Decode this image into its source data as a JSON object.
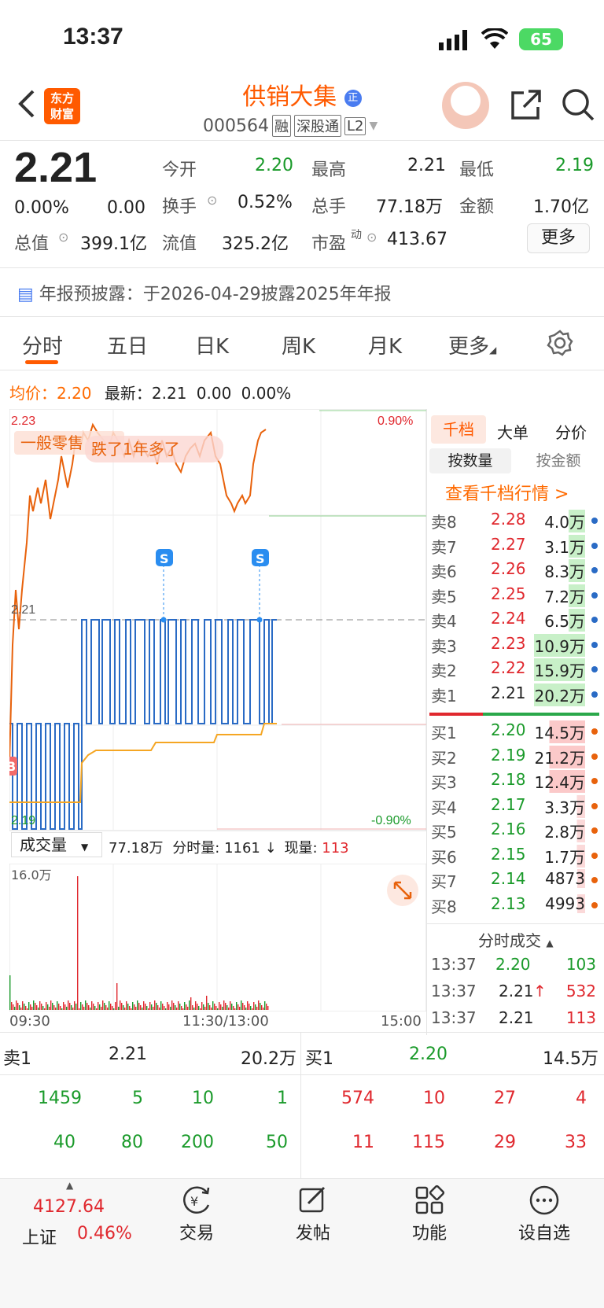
{
  "status": {
    "time": "13:37",
    "battery": "65"
  },
  "header": {
    "back_icon": "chevron-left-icon",
    "logo_text": "东方财富",
    "name": "供销大集",
    "code": "000564",
    "tags": [
      "融",
      "深股通",
      "L2"
    ],
    "share_icon": "share-icon",
    "search_icon": "search-icon"
  },
  "quote": {
    "price": "2.21",
    "change_pct": "0.00%",
    "change": "0.00",
    "open_label": "今开",
    "open": "2.20",
    "high_label": "最高",
    "high": "2.21",
    "low_label": "最低",
    "low": "2.19",
    "turnover_label": "换手",
    "turnover": "0.52%",
    "volume_label": "总手",
    "volume": "77.18万",
    "amount_label": "金额",
    "amount": "1.70亿",
    "mktcap_label": "总值",
    "mktcap": "399.1亿",
    "float_label": "流值",
    "float": "325.2亿",
    "pe_label": "市盈",
    "pe_sup": "动",
    "pe": "413.67",
    "more": "更多"
  },
  "notice": "年报预披露：于2026-04-29披露2025年年报",
  "tabs": [
    "分时",
    "五日",
    "日K",
    "周K",
    "月K",
    "更多"
  ],
  "avg_row": {
    "avg_label": "均价：",
    "avg": "2.20",
    "latest_label": "最新：",
    "latest": "2.21",
    "chg": "0.00",
    "pct": "0.00%"
  },
  "chart": {
    "ymax": "2.23",
    "ymin": "2.19",
    "mid": "2.21",
    "pct_top": "0.90%",
    "pct_bottom": "-0.90%",
    "overlay_tag": "一般零售",
    "overlay_text": "跌了1年多了",
    "sell_marker": "S",
    "buy_marker": "B"
  },
  "vol_header": {
    "select": "成交量",
    "total": "77.18万",
    "fs_label": "分时量:",
    "fs": "1161",
    "now_label": "现量:",
    "now": "113"
  },
  "vol_chart": {
    "ymax": "16.0万",
    "t_start": "09:30",
    "t_mid": "11:30/13:00",
    "t_end": "15:00"
  },
  "chart_data": {
    "type": "line",
    "price_range": [
      2.19,
      2.23
    ],
    "prev_close": 2.21,
    "volume_max": 160000
  },
  "orderbook": {
    "tabs": [
      "千档",
      "大单",
      "分价"
    ],
    "sub_tabs": [
      "按数量",
      "按金额"
    ],
    "link": "查看千档行情 >",
    "asks": [
      {
        "label": "卖8",
        "price": "2.28",
        "vol": "4.0万"
      },
      {
        "label": "卖7",
        "price": "2.27",
        "vol": "3.1万"
      },
      {
        "label": "卖6",
        "price": "2.26",
        "vol": "8.3万"
      },
      {
        "label": "卖5",
        "price": "2.25",
        "vol": "7.2万"
      },
      {
        "label": "卖4",
        "price": "2.24",
        "vol": "6.5万"
      },
      {
        "label": "卖3",
        "price": "2.23",
        "vol": "10.9万"
      },
      {
        "label": "卖2",
        "price": "2.22",
        "vol": "15.9万"
      },
      {
        "label": "卖1",
        "price": "2.21",
        "vol": "20.2万"
      }
    ],
    "bids": [
      {
        "label": "买1",
        "price": "2.20",
        "vol": "14.5万"
      },
      {
        "label": "买2",
        "price": "2.19",
        "vol": "21.2万"
      },
      {
        "label": "买3",
        "price": "2.18",
        "vol": "12.4万"
      },
      {
        "label": "买4",
        "price": "2.17",
        "vol": "3.3万"
      },
      {
        "label": "买5",
        "price": "2.16",
        "vol": "2.8万"
      },
      {
        "label": "买6",
        "price": "2.15",
        "vol": "1.7万"
      },
      {
        "label": "买7",
        "price": "2.14",
        "vol": "4873"
      },
      {
        "label": "买8",
        "price": "2.13",
        "vol": "4993"
      }
    ],
    "trades_title": "分时成交",
    "trades": [
      {
        "time": "13:37",
        "price": "2.20",
        "vol": "103"
      },
      {
        "time": "13:37",
        "price": "2.21",
        "vol": "532"
      },
      {
        "time": "13:37",
        "price": "2.21",
        "vol": "113"
      }
    ]
  },
  "queue": {
    "sell_label": "卖1",
    "sell_price": "2.21",
    "sell_vol": "20.2万",
    "buy_label": "买1",
    "buy_price": "2.20",
    "buy_vol": "14.5万",
    "sell_row1": [
      "1459",
      "5",
      "10",
      "1"
    ],
    "sell_row2": [
      "40",
      "80",
      "200",
      "50"
    ],
    "buy_row1": [
      "574",
      "10",
      "27",
      "4"
    ],
    "buy_row2": [
      "11",
      "115",
      "29",
      "33"
    ]
  },
  "bottom": {
    "index_value": "4127.64",
    "index_name": "上证",
    "index_pct": "0.46%",
    "trade": "交易",
    "post": "发帖",
    "func": "功能",
    "watch": "设自选"
  }
}
